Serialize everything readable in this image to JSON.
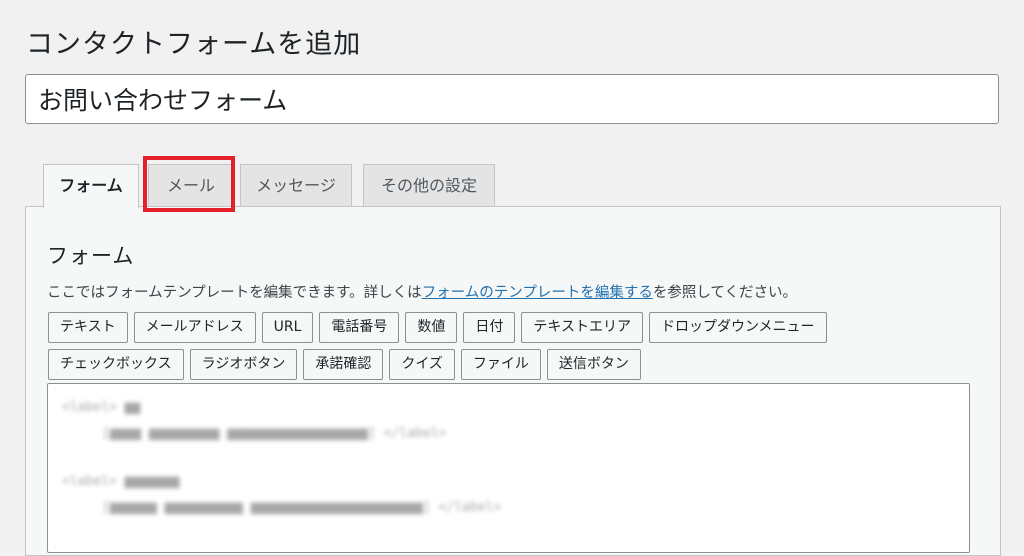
{
  "page": {
    "title": "コンタクトフォームを追加"
  },
  "form_title": {
    "value": "お問い合わせフォーム"
  },
  "tabs": [
    {
      "label": "フォーム",
      "active": true
    },
    {
      "label": "メール",
      "highlighted": true
    },
    {
      "label": "メッセージ"
    },
    {
      "label": "その他の設定"
    }
  ],
  "panel": {
    "heading": "フォーム",
    "description_prefix": "ここではフォームテンプレートを編集できます。詳しくは",
    "description_link": "フォームのテンプレートを編集する",
    "description_suffix": "を参照してください。"
  },
  "tag_buttons_row1": [
    "テキスト",
    "メールアドレス",
    "URL",
    "電話番号",
    "数値",
    "日付",
    "テキストエリア",
    "ドロップダウンメニュー"
  ],
  "tag_buttons_row2": [
    "チェックボックス",
    "ラジオボタン",
    "承諾確認",
    "クイズ",
    "ファイル",
    "送信ボタン"
  ],
  "colors": {
    "highlight": "#e4202b",
    "link": "#2271b1",
    "background": "#f1f1f1"
  }
}
